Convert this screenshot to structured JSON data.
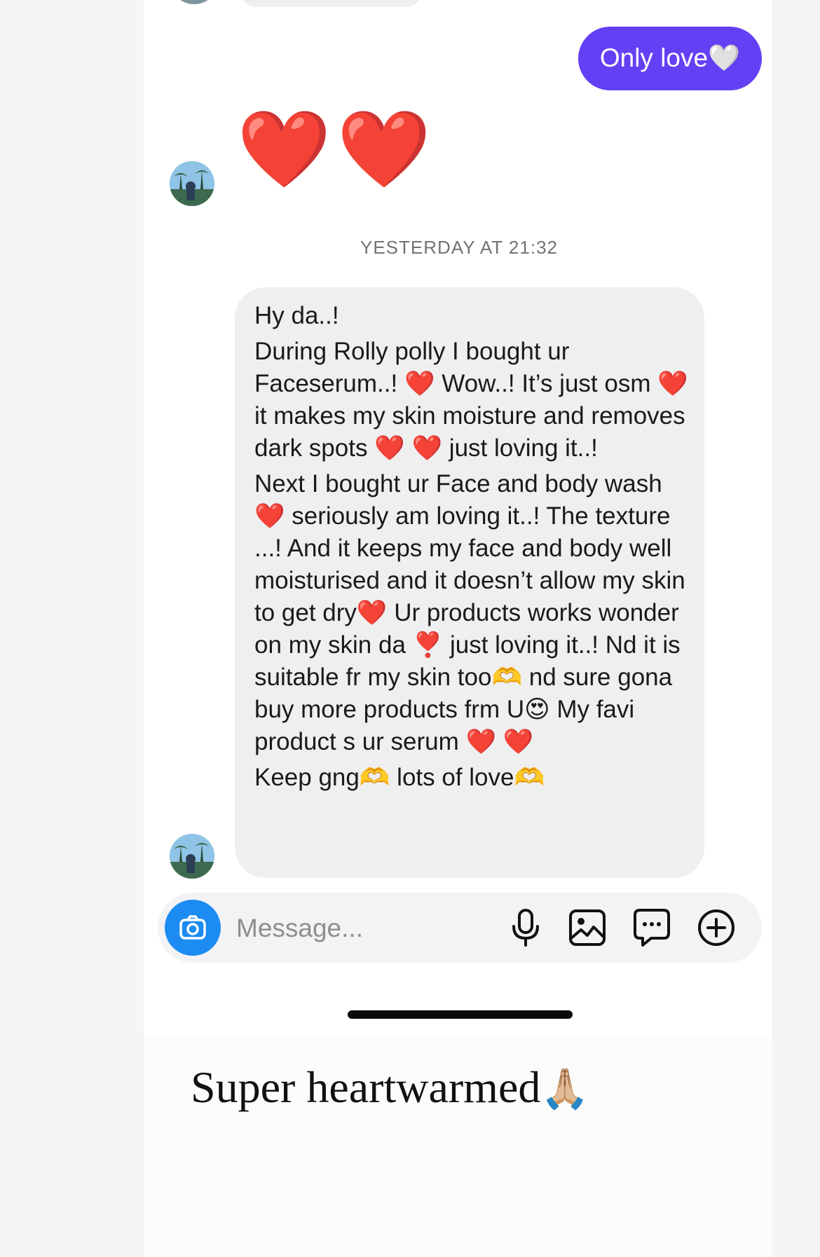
{
  "thread": {
    "sent_message": "Only love🤍",
    "reaction_hearts": "❤️❤️",
    "timestamp": "YESTERDAY AT 21:32",
    "received_paragraphs": [
      "Hy da..!",
      "During Rolly polly I bought ur Faceserum..! ❤️ Wow..! It’s just osm ❤️ it makes my skin moisture and removes dark spots ❤️ ❤️ just loving it..!",
      "Next I bought ur Face and body wash❤️ seriously am loving it..! The texture ...! And it keeps my face and body well moisturised and it doesn’t allow my skin to get dry❤️ Ur products works wonder on my skin da ❣️ just loving it..! Nd it is suitable fr my skin too🫶 nd sure gona buy more products frm U😍 My favi product s ur serum ❤️ ❤️",
      "Keep gng🫶 lots of love🫶"
    ]
  },
  "composer": {
    "placeholder": "Message...",
    "icons": [
      "camera-icon",
      "microphone-icon",
      "image-icon",
      "sticker-chat-icon",
      "add-icon"
    ]
  },
  "caption": {
    "text": "Super heartwarmed",
    "emoji": "🙏🏼"
  },
  "colors": {
    "sent_bubble": "#6440f5",
    "received_bubble": "#efeff0",
    "camera_button": "#1c8cf3",
    "heart": "#e3152a"
  }
}
